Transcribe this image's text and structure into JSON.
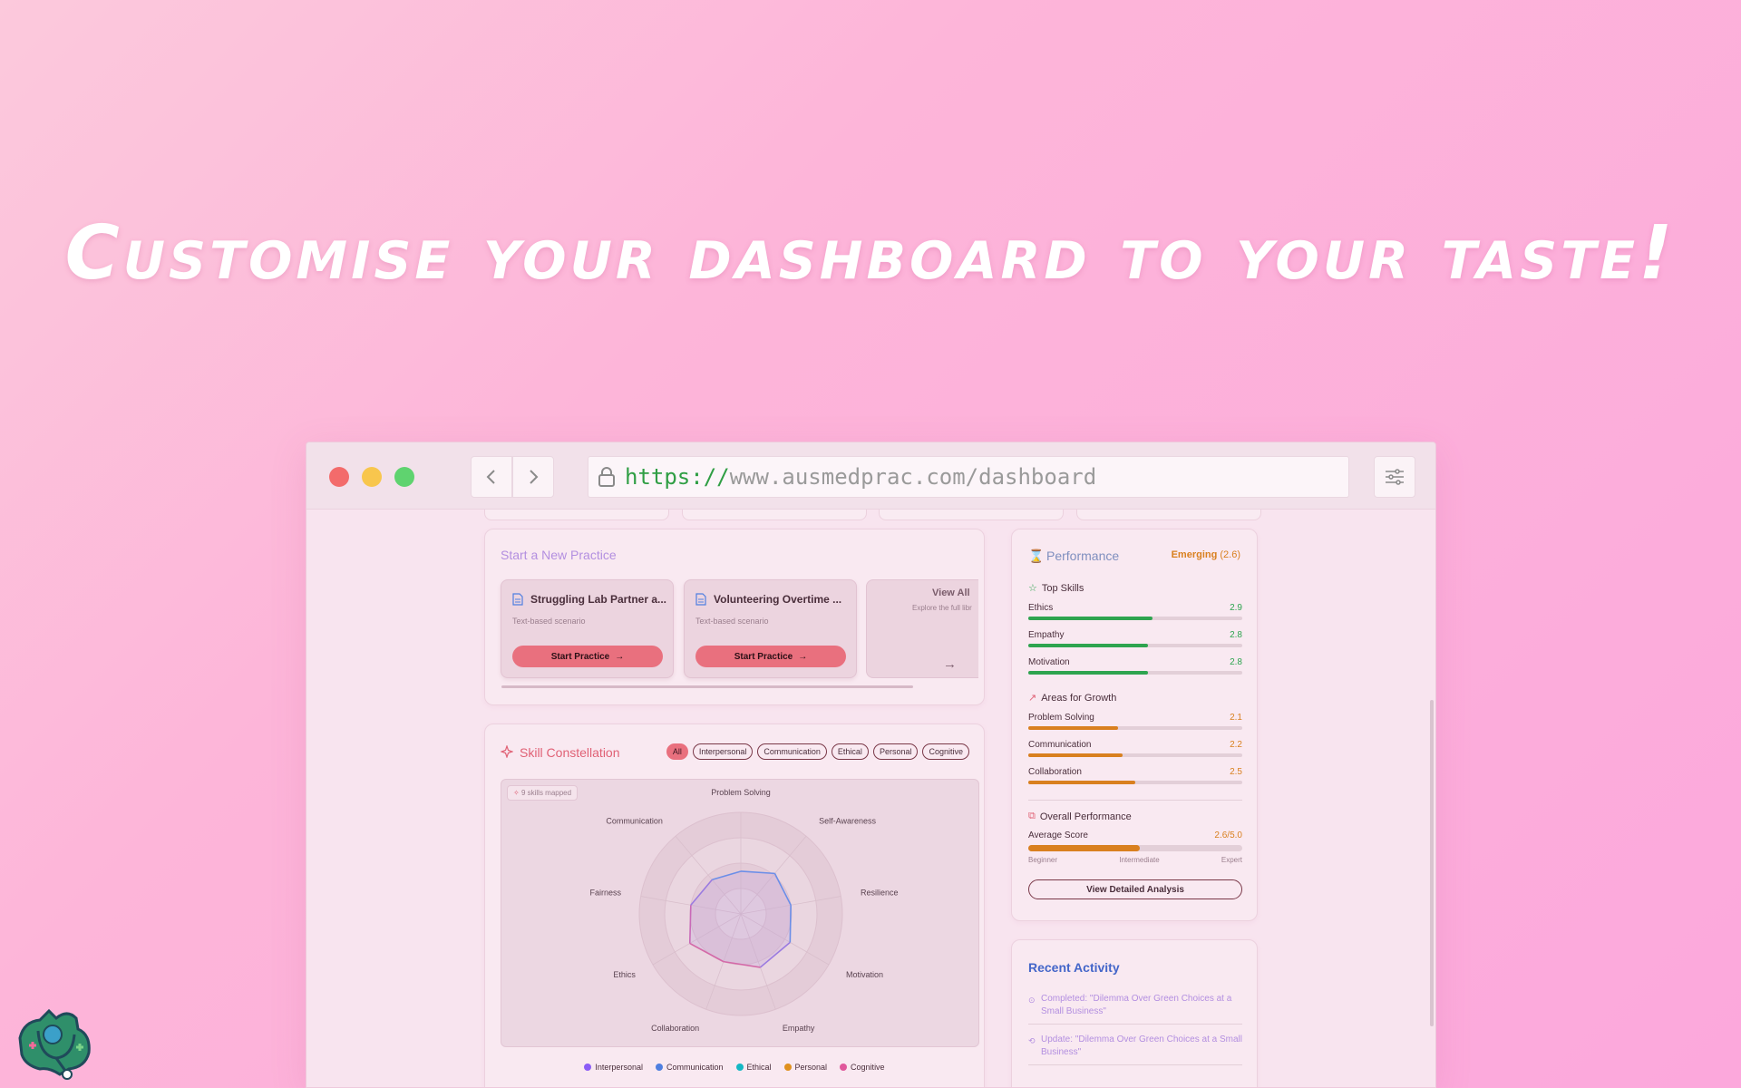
{
  "headline": "Customise your dashboard to your taste!",
  "browser": {
    "url_scheme": "https://",
    "url_rest": "www.ausmedprac.com/dashboard"
  },
  "practice": {
    "title": "Start a New Practice",
    "scenarios": [
      {
        "title": "Struggling Lab Partner a...",
        "subtitle": "Text-based scenario",
        "button": "Start Practice"
      },
      {
        "title": "Volunteering Overtime ...",
        "subtitle": "Text-based scenario",
        "button": "Start Practice"
      }
    ],
    "view_all": {
      "title": "View All",
      "subtitle": "Explore the full libr"
    }
  },
  "constellation": {
    "title": "Skill Constellation",
    "filters": [
      "All",
      "Interpersonal",
      "Communication",
      "Ethical",
      "Personal",
      "Cognitive"
    ],
    "active_filter": "All",
    "badge": "9 skills mapped",
    "legend": [
      {
        "name": "Interpersonal",
        "color": "#8b5cf6"
      },
      {
        "name": "Communication",
        "color": "#4f7fe0"
      },
      {
        "name": "Ethical",
        "color": "#14b8c4"
      },
      {
        "name": "Personal",
        "color": "#e0911f"
      },
      {
        "name": "Cognitive",
        "color": "#e0579b"
      }
    ]
  },
  "chart_data": {
    "type": "radar",
    "categories": [
      "Problem Solving",
      "Self-Awareness",
      "Resilience",
      "Motivation",
      "Empathy",
      "Collaboration",
      "Ethics",
      "Fairness",
      "Communication"
    ],
    "values": [
      2.1,
      2.6,
      2.5,
      2.8,
      2.8,
      2.5,
      2.9,
      2.5,
      2.2
    ],
    "rmax": 5
  },
  "performance": {
    "title": "Performance",
    "level_label": "Emerging",
    "level_score": "(2.6)",
    "top_skills_title": "Top Skills",
    "top_skills": [
      {
        "name": "Ethics",
        "value": "2.9",
        "fraction": 0.58
      },
      {
        "name": "Empathy",
        "value": "2.8",
        "fraction": 0.56
      },
      {
        "name": "Motivation",
        "value": "2.8",
        "fraction": 0.56
      }
    ],
    "growth_title": "Areas for Growth",
    "growth_skills": [
      {
        "name": "Problem Solving",
        "value": "2.1",
        "fraction": 0.42
      },
      {
        "name": "Communication",
        "value": "2.2",
        "fraction": 0.44
      },
      {
        "name": "Collaboration",
        "value": "2.5",
        "fraction": 0.5
      }
    ],
    "overall_title": "Overall Performance",
    "avg_label": "Average Score",
    "avg_value": "2.6/5.0",
    "avg_fraction": 0.52,
    "scale": [
      "Beginner",
      "Intermediate",
      "Expert"
    ],
    "button": "View Detailed Analysis",
    "colors": {
      "top": "#2ea44f",
      "growth": "#d9801f"
    }
  },
  "activity": {
    "title": "Recent Activity",
    "items": [
      {
        "text": "Completed: \"Dilemma Over Green Choices at a Small Business\""
      },
      {
        "text": "Update: \"Dilemma Over Green Choices at a Small Business\""
      }
    ]
  }
}
